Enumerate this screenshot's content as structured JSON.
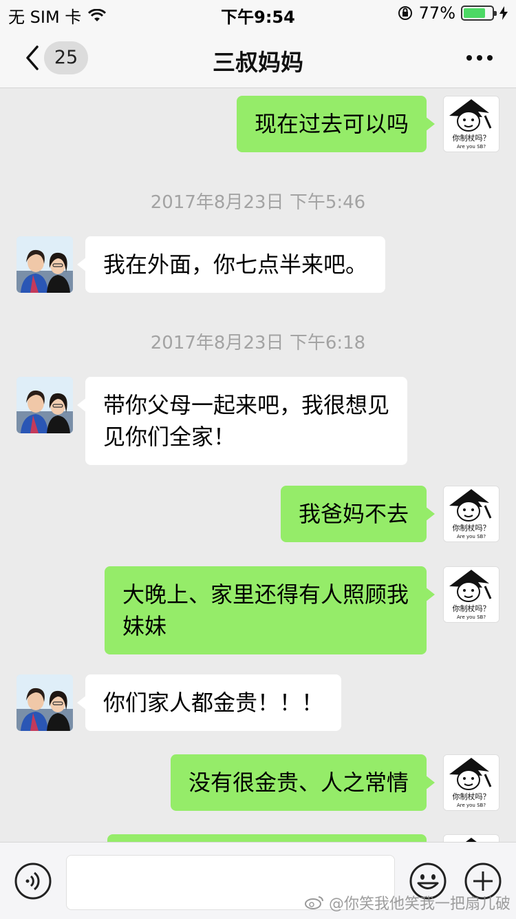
{
  "status_bar": {
    "carrier": "无 SIM 卡",
    "time": "下午9:54",
    "battery": "77%",
    "battery_level": 0.77
  },
  "nav": {
    "back_count": "25",
    "title": "三叔妈妈"
  },
  "messages": [
    {
      "type": "sent",
      "text": "现在过去可以吗"
    },
    {
      "type": "time",
      "text": "2017年8月23日 下午5:46"
    },
    {
      "type": "recv",
      "text": "我在外面，你七点半来吧。"
    },
    {
      "type": "time",
      "text": "2017年8月23日 下午6:18"
    },
    {
      "type": "recv",
      "text": "带你父母一起来吧，我很想见\n见你们全家！"
    },
    {
      "type": "sent",
      "text": "我爸妈不去"
    },
    {
      "type": "sent",
      "text": "大晚上、家里还得有人照顾我\n妹妹"
    },
    {
      "type": "recv",
      "text": "你们家人都金贵！！！"
    },
    {
      "type": "sent",
      "text": "没有很金贵、人之常情"
    }
  ],
  "sticker": {
    "caption": "你制杖吗？",
    "subcaption": "Are you SB?"
  },
  "watermark": "@你笑我他笑我一把扇儿破",
  "colors": {
    "sent_bubble": "#95ec69",
    "recv_bubble": "#ffffff",
    "background": "#ebebeb"
  }
}
